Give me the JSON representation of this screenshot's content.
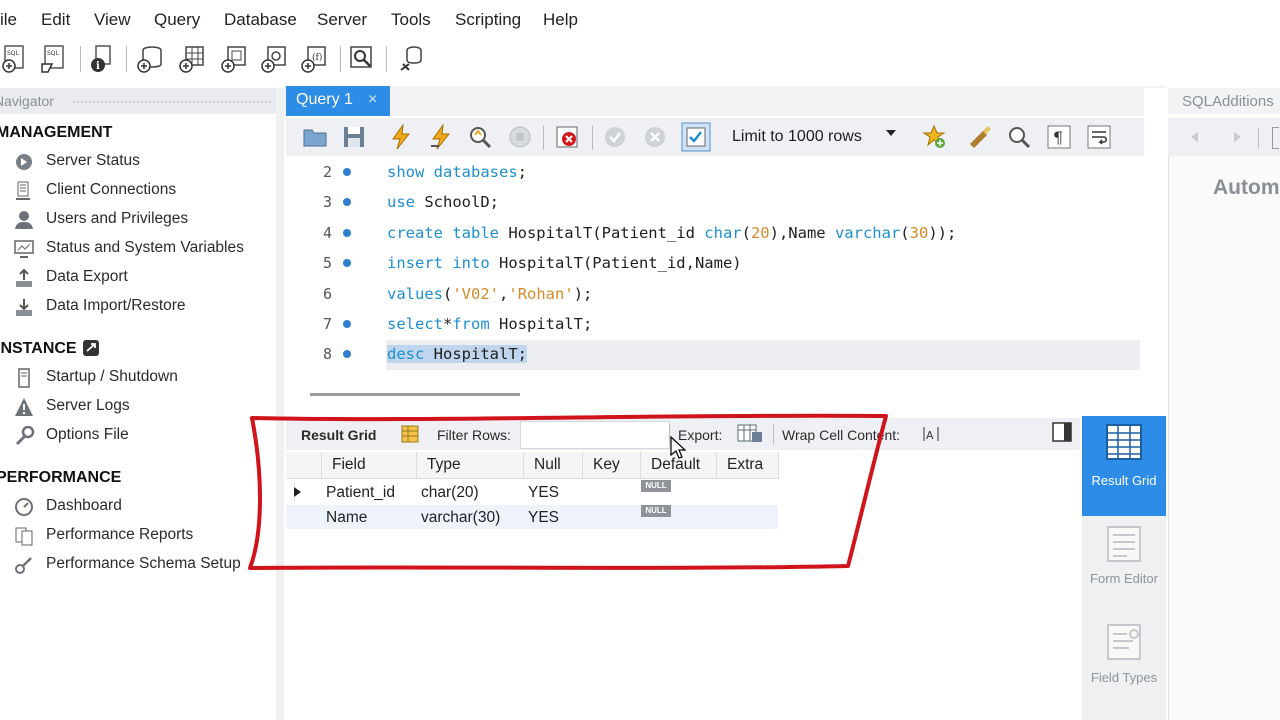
{
  "menubar": {
    "items": [
      "ile",
      "Edit",
      "View",
      "Query",
      "Database",
      "Server",
      "Tools",
      "Scripting",
      "Help"
    ]
  },
  "navigator": {
    "title": "Navigator",
    "sections": [
      {
        "title": "MANAGEMENT",
        "items": [
          "Server Status",
          "Client Connections",
          "Users and Privileges",
          "Status and System Variables",
          "Data Export",
          "Data Import/Restore"
        ]
      },
      {
        "title": "INSTANCE",
        "items": [
          "Startup / Shutdown",
          "Server Logs",
          "Options File"
        ]
      },
      {
        "title": "PERFORMANCE",
        "items": [
          "Dashboard",
          "Performance Reports",
          "Performance Schema Setup"
        ]
      }
    ]
  },
  "query_tab": {
    "label": "Query 1",
    "close": "×"
  },
  "sql_toolbar": {
    "limit_value": "Limit to 1000 rows"
  },
  "editor": {
    "lines": [
      {
        "number": "2",
        "text": "show databases;"
      },
      {
        "number": "3",
        "text": "use SchoolD;"
      },
      {
        "number": "4",
        "text": "create table HospitalT(Patient_id char(20),Name varchar(30));"
      },
      {
        "number": "5",
        "text": "insert into HospitalT(Patient_id,Name)"
      },
      {
        "number": "6",
        "text": "values('V02','Rohan');"
      },
      {
        "number": "7",
        "text": "select*from HospitalT;"
      },
      {
        "number": "8",
        "text": "desc HospitalT;"
      }
    ]
  },
  "result_toolbar": {
    "result_grid": "Result Grid",
    "filter_rows": "Filter Rows:",
    "filter_value": "",
    "export": "Export:",
    "wrap": "Wrap Cell Content:"
  },
  "result_grid": {
    "columns": [
      "Field",
      "Type",
      "Null",
      "Key",
      "Default",
      "Extra"
    ],
    "rows": [
      {
        "field": "Patient_id",
        "type": "char(20)",
        "null": "YES",
        "key": "",
        "default": "NULL",
        "extra": ""
      },
      {
        "field": "Name",
        "type": "varchar(30)",
        "null": "YES",
        "key": "",
        "default": "NULL",
        "extra": ""
      }
    ]
  },
  "side_panel": {
    "result_grid": "Result Grid",
    "form_editor": "Form Editor",
    "field_types": "Field Types"
  },
  "sql_additions": {
    "title": "SQLAdditions",
    "body_text": "Autom"
  },
  "colors": {
    "accent": "#2c8ce6",
    "annotation": "#d0141c",
    "keyword": "#1f8fcf",
    "string": "#d38b2a"
  }
}
